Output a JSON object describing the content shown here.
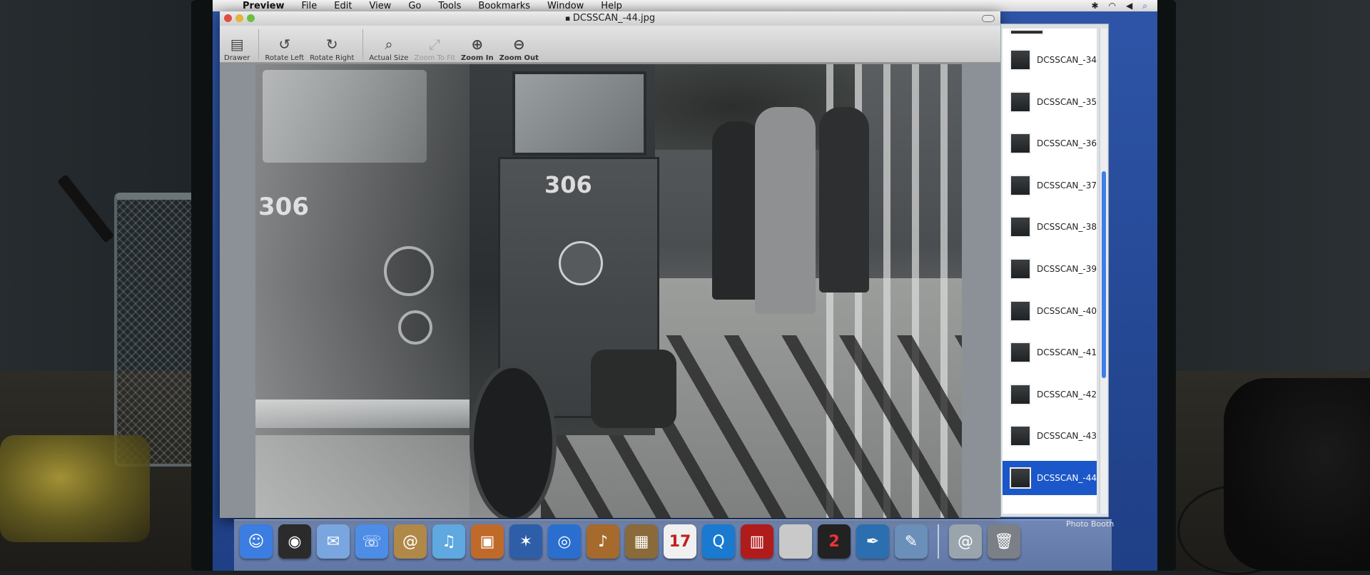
{
  "menubar": {
    "app": "Preview",
    "items": [
      "File",
      "Edit",
      "View",
      "Go",
      "Tools",
      "Bookmarks",
      "Window",
      "Help"
    ]
  },
  "window": {
    "title": "DCSSCAN_-44.jpg"
  },
  "toolbar": {
    "items": [
      {
        "label": "Drawer",
        "icon": "drawer-icon",
        "glyph": "▤",
        "enabled": true
      },
      {
        "label": "Rotate Left",
        "icon": "rotate-left-icon",
        "glyph": "↺",
        "enabled": true
      },
      {
        "label": "Rotate Right",
        "icon": "rotate-right-icon",
        "glyph": "↻",
        "enabled": true
      },
      {
        "label": "Actual Size",
        "icon": "actual-size-icon",
        "glyph": "⌕",
        "enabled": true
      },
      {
        "label": "Zoom To Fit",
        "icon": "zoom-to-fit-icon",
        "glyph": "⤢",
        "enabled": false
      },
      {
        "label": "Zoom In",
        "icon": "zoom-in-icon",
        "glyph": "⊕",
        "enabled": true
      },
      {
        "label": "Zoom Out",
        "icon": "zoom-out-icon",
        "glyph": "⊖",
        "enabled": true
      }
    ]
  },
  "photo": {
    "truck_number_hood": "306",
    "truck_number_door": "306"
  },
  "drawer": {
    "items": [
      {
        "label": "DCSSCAN_-34",
        "selected": false
      },
      {
        "label": "DCSSCAN_-35",
        "selected": false
      },
      {
        "label": "DCSSCAN_-36",
        "selected": false
      },
      {
        "label": "DCSSCAN_-37",
        "selected": false
      },
      {
        "label": "DCSSCAN_-38",
        "selected": false
      },
      {
        "label": "DCSSCAN_-39",
        "selected": false
      },
      {
        "label": "DCSSCAN_-40",
        "selected": false
      },
      {
        "label": "DCSSCAN_-41",
        "selected": false
      },
      {
        "label": "DCSSCAN_-42",
        "selected": false
      },
      {
        "label": "DCSSCAN_-43",
        "selected": false
      },
      {
        "label": "DCSSCAN_-44",
        "selected": true
      }
    ]
  },
  "dock": {
    "label": "Photo Booth",
    "calendar_day": "17",
    "badge": "2",
    "items": [
      {
        "name": "finder-icon",
        "glyph": "☺",
        "color": "#3b7de0"
      },
      {
        "name": "dashboard-icon",
        "glyph": "◉",
        "color": "#2b2b2b"
      },
      {
        "name": "mail-stamp-icon",
        "glyph": "✉",
        "color": "#7aa6e0"
      },
      {
        "name": "ichat-icon",
        "glyph": "☏",
        "color": "#4d8de6"
      },
      {
        "name": "address-book-icon",
        "glyph": "@",
        "color": "#b08848"
      },
      {
        "name": "itunes-icon",
        "glyph": "♫",
        "color": "#5fa8e0"
      },
      {
        "name": "iphoto-icon",
        "glyph": "▣",
        "color": "#c06a2a"
      },
      {
        "name": "imovie-icon",
        "glyph": "✶",
        "color": "#2e5ea8"
      },
      {
        "name": "idvd-icon",
        "glyph": "◎",
        "color": "#2a6fd0"
      },
      {
        "name": "garageband-icon",
        "glyph": "♪",
        "color": "#a56a2c"
      },
      {
        "name": "iweb-icon",
        "glyph": "▦",
        "color": "#8a6a3a"
      },
      {
        "name": "ical-icon",
        "glyph": "",
        "color": "#f0f0f0"
      },
      {
        "name": "quicktime-icon",
        "glyph": "Q",
        "color": "#1a7ad0"
      },
      {
        "name": "photo-booth-icon",
        "glyph": "▥",
        "color": "#b01c1c"
      },
      {
        "name": "system-preferences-icon",
        "glyph": "",
        "color": "#c9c9c9"
      },
      {
        "name": "iphoto-2-icon",
        "glyph": "",
        "color": "#222222"
      },
      {
        "name": "feather-icon",
        "glyph": "✒",
        "color": "#2c6fb0"
      },
      {
        "name": "preview-icon",
        "glyph": "✎",
        "color": "#6a8fb8"
      },
      {
        "name": "sep",
        "glyph": "",
        "color": ""
      },
      {
        "name": "mail-icon",
        "glyph": "@",
        "color": "#9aa4ad"
      },
      {
        "name": "trash-icon",
        "glyph": "🗑",
        "color": "#7b8086"
      }
    ]
  }
}
